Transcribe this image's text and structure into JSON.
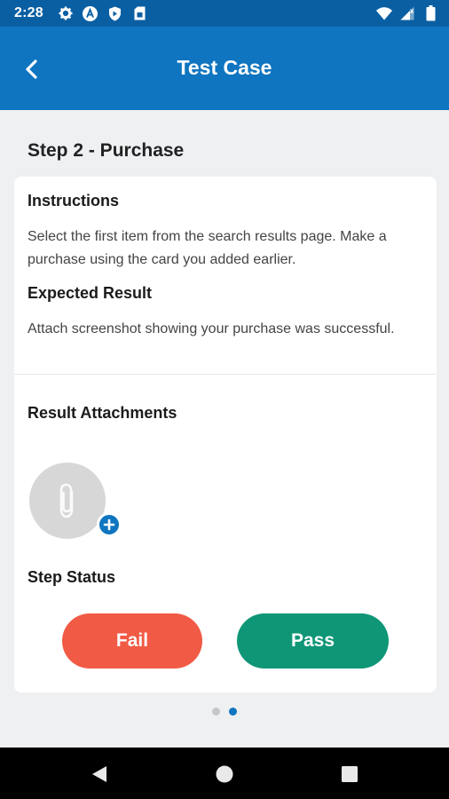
{
  "status_bar": {
    "time": "2:28",
    "left_icons": [
      "settings-icon",
      "a-icon",
      "shield-icon",
      "sim-card-icon"
    ],
    "right_icons": [
      "wifi-icon",
      "signal-icon",
      "battery-icon"
    ]
  },
  "app_bar": {
    "title": "Test Case",
    "back_icon": "chevron-left-icon"
  },
  "step": {
    "title": "Step 2 - Purchase"
  },
  "instructions": {
    "heading": "Instructions",
    "text": "Select the first item from the search results page. Make a purchase using the card you added earlier."
  },
  "expected_result": {
    "heading": "Expected Result",
    "text": "Attach screenshot showing your purchase was successful."
  },
  "attachments": {
    "heading": "Result Attachments",
    "icon": "paperclip-icon",
    "add_icon": "plus-icon"
  },
  "step_status": {
    "heading": "Step Status",
    "fail_label": "Fail",
    "pass_label": "Pass"
  },
  "pager": {
    "total": 2,
    "active_index": 1
  },
  "colors": {
    "status_bar": "#0a5fa3",
    "app_bar": "#0f75c0",
    "fail": "#f15a44",
    "pass": "#0f9677",
    "background": "#eef0f2"
  },
  "nav_bar": {
    "icons": [
      "back-triangle-icon",
      "home-circle-icon",
      "recents-square-icon"
    ]
  }
}
